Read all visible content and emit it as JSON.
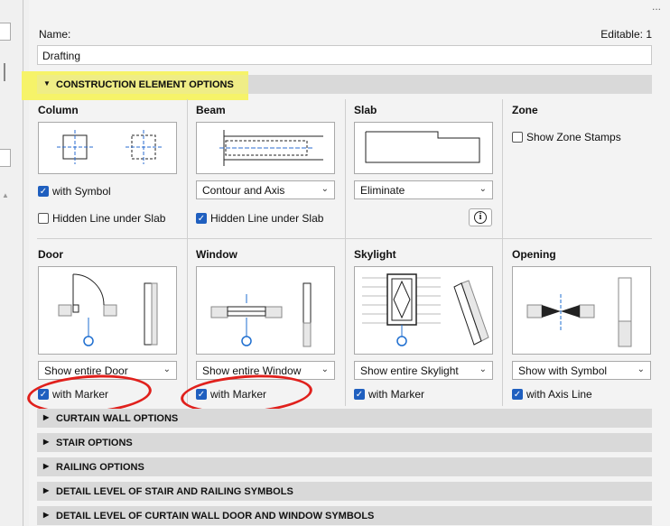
{
  "window": {
    "top_right_glyph": "..."
  },
  "form": {
    "name_label": "Name:",
    "name_value": "Drafting",
    "editable_label": "Editable: 1"
  },
  "sections": {
    "construction": "CONSTRUCTION ELEMENT OPTIONS",
    "curtain_wall": "CURTAIN WALL OPTIONS",
    "stair": "STAIR OPTIONS",
    "railing": "RAILING OPTIONS",
    "detail_stair": "DETAIL LEVEL OF STAIR AND RAILING SYMBOLS",
    "detail_curtain": "DETAIL LEVEL OF CURTAIN WALL DOOR AND WINDOW SYMBOLS"
  },
  "column": {
    "title": "Column",
    "with_symbol": "with Symbol",
    "hidden_line": "Hidden Line under Slab"
  },
  "beam": {
    "title": "Beam",
    "dropdown": "Contour and Axis",
    "hidden_line": "Hidden Line under Slab"
  },
  "slab": {
    "title": "Slab",
    "dropdown": "Eliminate",
    "info_glyph": "i"
  },
  "zone": {
    "title": "Zone",
    "show_stamps": "Show Zone Stamps"
  },
  "door": {
    "title": "Door",
    "dropdown": "Show entire Door",
    "with_marker": "with Marker"
  },
  "window_el": {
    "title": "Window",
    "dropdown": "Show entire Window",
    "with_marker": "with Marker"
  },
  "skylight": {
    "title": "Skylight",
    "dropdown": "Show entire Skylight",
    "with_marker": "with Marker"
  },
  "opening": {
    "title": "Opening",
    "dropdown": "Show with Symbol",
    "with_axis": "with Axis Line"
  },
  "glyphs": {
    "check": "✓",
    "chevron": "⌄",
    "tri_down": "▼",
    "tri_right": "▶"
  },
  "colors": {
    "accent": "#1f5fbf",
    "highlight": "#f5f36a",
    "annotation": "#e0201c",
    "marker": "#1f6fd0"
  }
}
